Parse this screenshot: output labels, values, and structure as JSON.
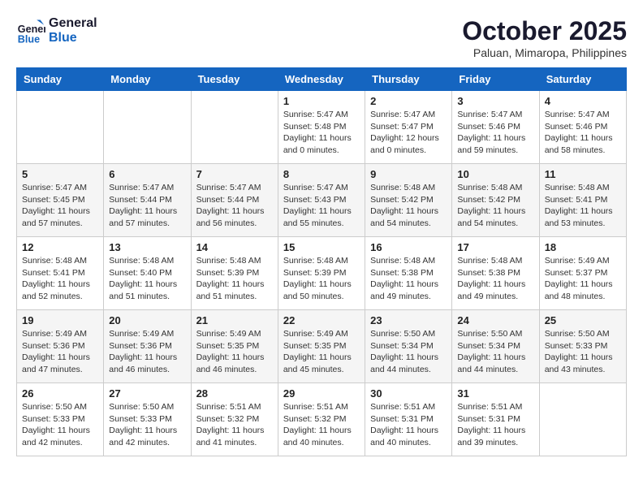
{
  "logo": {
    "line1": "General",
    "line2": "Blue"
  },
  "title": "October 2025",
  "subtitle": "Paluan, Mimaropa, Philippines",
  "days_of_week": [
    "Sunday",
    "Monday",
    "Tuesday",
    "Wednesday",
    "Thursday",
    "Friday",
    "Saturday"
  ],
  "weeks": [
    [
      {
        "day": "",
        "info": ""
      },
      {
        "day": "",
        "info": ""
      },
      {
        "day": "",
        "info": ""
      },
      {
        "day": "1",
        "info": "Sunrise: 5:47 AM\nSunset: 5:48 PM\nDaylight: 11 hours\nand 0 minutes."
      },
      {
        "day": "2",
        "info": "Sunrise: 5:47 AM\nSunset: 5:47 PM\nDaylight: 12 hours\nand 0 minutes."
      },
      {
        "day": "3",
        "info": "Sunrise: 5:47 AM\nSunset: 5:46 PM\nDaylight: 11 hours\nand 59 minutes."
      },
      {
        "day": "4",
        "info": "Sunrise: 5:47 AM\nSunset: 5:46 PM\nDaylight: 11 hours\nand 58 minutes."
      }
    ],
    [
      {
        "day": "5",
        "info": "Sunrise: 5:47 AM\nSunset: 5:45 PM\nDaylight: 11 hours\nand 57 minutes."
      },
      {
        "day": "6",
        "info": "Sunrise: 5:47 AM\nSunset: 5:44 PM\nDaylight: 11 hours\nand 57 minutes."
      },
      {
        "day": "7",
        "info": "Sunrise: 5:47 AM\nSunset: 5:44 PM\nDaylight: 11 hours\nand 56 minutes."
      },
      {
        "day": "8",
        "info": "Sunrise: 5:47 AM\nSunset: 5:43 PM\nDaylight: 11 hours\nand 55 minutes."
      },
      {
        "day": "9",
        "info": "Sunrise: 5:48 AM\nSunset: 5:42 PM\nDaylight: 11 hours\nand 54 minutes."
      },
      {
        "day": "10",
        "info": "Sunrise: 5:48 AM\nSunset: 5:42 PM\nDaylight: 11 hours\nand 54 minutes."
      },
      {
        "day": "11",
        "info": "Sunrise: 5:48 AM\nSunset: 5:41 PM\nDaylight: 11 hours\nand 53 minutes."
      }
    ],
    [
      {
        "day": "12",
        "info": "Sunrise: 5:48 AM\nSunset: 5:41 PM\nDaylight: 11 hours\nand 52 minutes."
      },
      {
        "day": "13",
        "info": "Sunrise: 5:48 AM\nSunset: 5:40 PM\nDaylight: 11 hours\nand 51 minutes."
      },
      {
        "day": "14",
        "info": "Sunrise: 5:48 AM\nSunset: 5:39 PM\nDaylight: 11 hours\nand 51 minutes."
      },
      {
        "day": "15",
        "info": "Sunrise: 5:48 AM\nSunset: 5:39 PM\nDaylight: 11 hours\nand 50 minutes."
      },
      {
        "day": "16",
        "info": "Sunrise: 5:48 AM\nSunset: 5:38 PM\nDaylight: 11 hours\nand 49 minutes."
      },
      {
        "day": "17",
        "info": "Sunrise: 5:48 AM\nSunset: 5:38 PM\nDaylight: 11 hours\nand 49 minutes."
      },
      {
        "day": "18",
        "info": "Sunrise: 5:49 AM\nSunset: 5:37 PM\nDaylight: 11 hours\nand 48 minutes."
      }
    ],
    [
      {
        "day": "19",
        "info": "Sunrise: 5:49 AM\nSunset: 5:36 PM\nDaylight: 11 hours\nand 47 minutes."
      },
      {
        "day": "20",
        "info": "Sunrise: 5:49 AM\nSunset: 5:36 PM\nDaylight: 11 hours\nand 46 minutes."
      },
      {
        "day": "21",
        "info": "Sunrise: 5:49 AM\nSunset: 5:35 PM\nDaylight: 11 hours\nand 46 minutes."
      },
      {
        "day": "22",
        "info": "Sunrise: 5:49 AM\nSunset: 5:35 PM\nDaylight: 11 hours\nand 45 minutes."
      },
      {
        "day": "23",
        "info": "Sunrise: 5:50 AM\nSunset: 5:34 PM\nDaylight: 11 hours\nand 44 minutes."
      },
      {
        "day": "24",
        "info": "Sunrise: 5:50 AM\nSunset: 5:34 PM\nDaylight: 11 hours\nand 44 minutes."
      },
      {
        "day": "25",
        "info": "Sunrise: 5:50 AM\nSunset: 5:33 PM\nDaylight: 11 hours\nand 43 minutes."
      }
    ],
    [
      {
        "day": "26",
        "info": "Sunrise: 5:50 AM\nSunset: 5:33 PM\nDaylight: 11 hours\nand 42 minutes."
      },
      {
        "day": "27",
        "info": "Sunrise: 5:50 AM\nSunset: 5:33 PM\nDaylight: 11 hours\nand 42 minutes."
      },
      {
        "day": "28",
        "info": "Sunrise: 5:51 AM\nSunset: 5:32 PM\nDaylight: 11 hours\nand 41 minutes."
      },
      {
        "day": "29",
        "info": "Sunrise: 5:51 AM\nSunset: 5:32 PM\nDaylight: 11 hours\nand 40 minutes."
      },
      {
        "day": "30",
        "info": "Sunrise: 5:51 AM\nSunset: 5:31 PM\nDaylight: 11 hours\nand 40 minutes."
      },
      {
        "day": "31",
        "info": "Sunrise: 5:51 AM\nSunset: 5:31 PM\nDaylight: 11 hours\nand 39 minutes."
      },
      {
        "day": "",
        "info": ""
      }
    ]
  ]
}
